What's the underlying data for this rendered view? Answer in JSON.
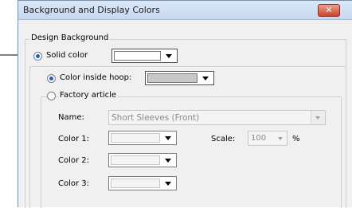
{
  "dialog": {
    "title": "Background and Display Colors",
    "close_glyph": "✕"
  },
  "design_background": {
    "label": "Design Background",
    "solid_color": {
      "label": "Solid color",
      "selected": true,
      "swatch_color": "#ffffff"
    },
    "color_inside_hoop": {
      "label": "Color inside hoop:",
      "selected": true,
      "swatch_color": "#c8c8c8"
    },
    "factory_article": {
      "label": "Factory article",
      "selected": false,
      "name_label": "Name:",
      "name_value": "Short Sleeves (Front)",
      "color1_label": "Color 1:",
      "color2_label": "Color 2:",
      "color3_label": "Color 3:",
      "scale_label": "Scale:",
      "scale_value": "100",
      "scale_unit": "%"
    }
  },
  "icons": {
    "combo_arrow": "chevron-down-icon",
    "callout": "pointer-arrow-icon"
  }
}
